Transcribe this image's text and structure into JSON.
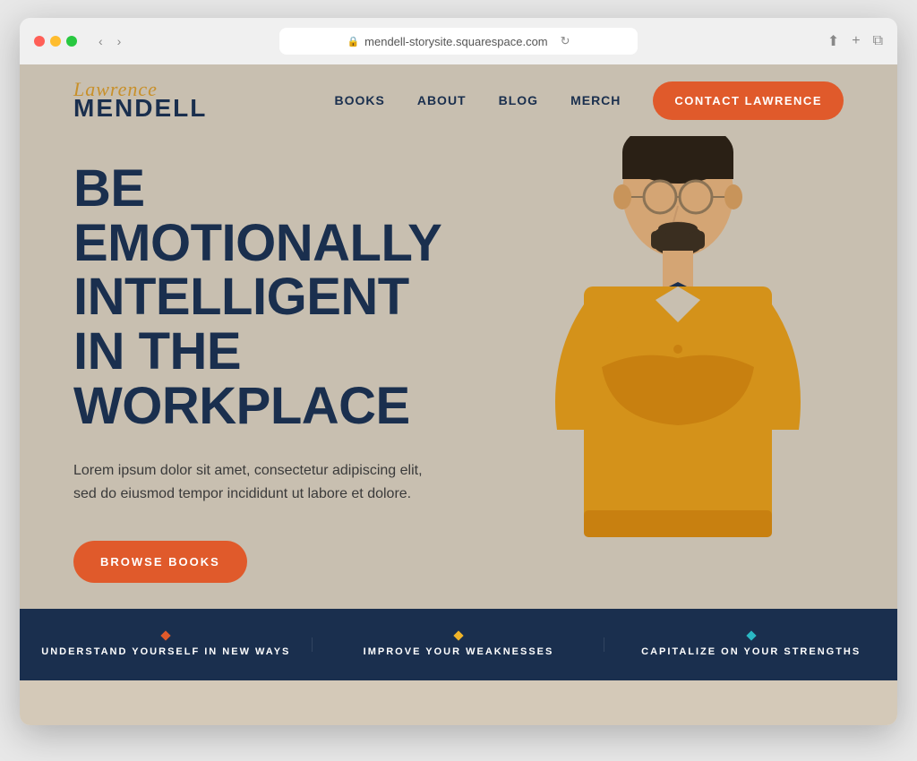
{
  "browser": {
    "url": "mendell-storysite.squarespace.com",
    "reload_label": "⟳",
    "back_label": "‹",
    "forward_label": "›",
    "share_label": "↑",
    "new_tab_label": "+",
    "windows_label": "⧉"
  },
  "header": {
    "logo_script": "Lawrence",
    "logo_main": "MENDELL",
    "nav": {
      "books": "BOOKS",
      "about": "ABOUT",
      "blog": "BLOG",
      "merch": "MERCH",
      "cta": "CONTACT LAWRENCE"
    }
  },
  "hero": {
    "title": "BE EMOTIONALLY INTELLIGENT IN THE WORKPLACE",
    "subtitle": "Lorem ipsum dolor sit amet, consectetur adipiscing elit, sed do eiusmod tempor incididunt ut labore et dolore.",
    "cta": "BROWSE BOOKS"
  },
  "features": [
    {
      "id": "feature-1",
      "text": "UNDERSTAND YOURSELF IN NEW WAYS",
      "diamond_color": "orange"
    },
    {
      "id": "feature-2",
      "text": "IMPROVE YOUR WEAKNESSES",
      "diamond_color": "yellow"
    },
    {
      "id": "feature-3",
      "text": "CAPITALIZE ON YOUR STRENGTHS",
      "diamond_color": "teal"
    }
  ],
  "colors": {
    "navy": "#1a2f4e",
    "orange": "#e05a2b",
    "gold": "#c8902a",
    "beige": "#c8bfb0",
    "teal": "#2ab8c4",
    "yellow": "#f0b429"
  }
}
